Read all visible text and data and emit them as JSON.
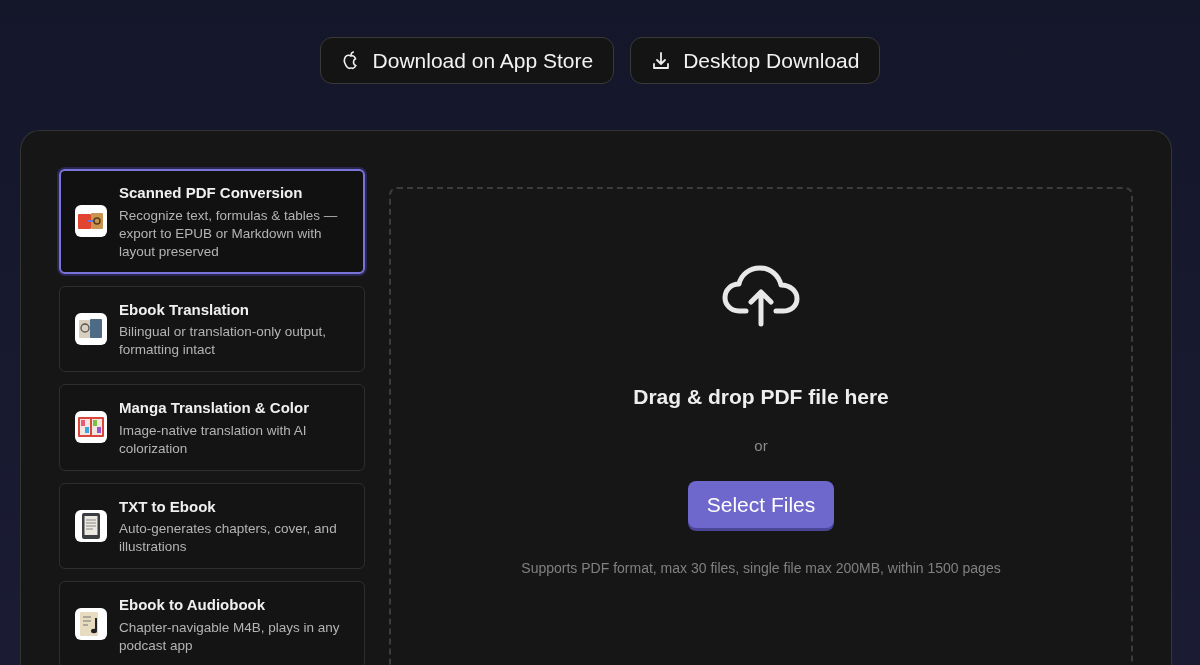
{
  "header_buttons": [
    {
      "kind": "apple",
      "label": "Download on App Store"
    },
    {
      "kind": "download",
      "label": "Desktop Download"
    }
  ],
  "features": [
    {
      "kind": "pdf",
      "title": "Scanned PDF Conversion",
      "description": "Recognize text, formulas & tables — export to EPUB or Markdown with layout preserved",
      "selected": true
    },
    {
      "kind": "translate",
      "title": "Ebook Translation",
      "description": "Bilingual or translation-only output, formatting intact",
      "selected": false
    },
    {
      "kind": "manga",
      "title": "Manga Translation & Color",
      "description": "Image-native translation with AI colorization",
      "selected": false
    },
    {
      "kind": "reader",
      "title": "TXT to Ebook",
      "description": "Auto-generates chapters, cover, and illustrations",
      "selected": false
    },
    {
      "kind": "audio",
      "title": "Ebook to Audiobook",
      "description": "Chapter-navigable M4B, plays in any podcast app",
      "selected": false
    }
  ],
  "dropzone": {
    "heading": "Drag & drop PDF file here",
    "separator": "or",
    "button": "Select Files",
    "note": "Supports PDF format, max 30 files, single file max 200MB, within 1500 pages"
  }
}
